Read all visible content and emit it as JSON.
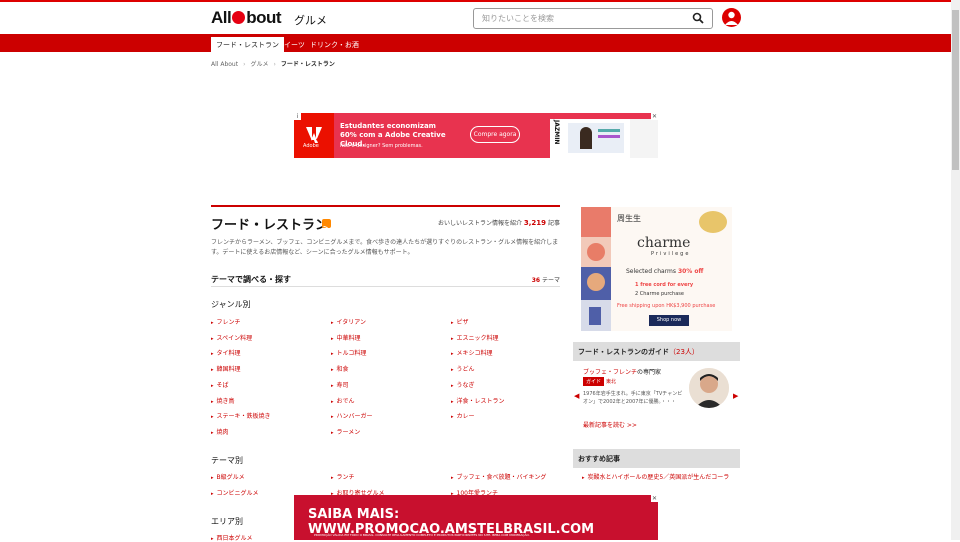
{
  "header": {
    "logo": "AllAbout",
    "category": "グルメ",
    "search_placeholder": "知りたいことを検索"
  },
  "nav": [
    {
      "label": "フード・レストラン",
      "active": true
    },
    {
      "label": "スイーツ",
      "active": false
    },
    {
      "label": "ドリンク・お酒",
      "active": false
    }
  ],
  "breadcrumb": [
    "All About",
    "グルメ",
    "フード・レストラン"
  ],
  "ad_top": {
    "brand": "Adobe",
    "headline": "Estudantes economizam 60% com a Adobe Creative Cloud.",
    "sub": "Não é designer? Sem problemas.",
    "button": "Compre agora",
    "side_brand": "JAZMIN"
  },
  "main": {
    "title": "フード・レストラン",
    "count_prefix": "おいしいレストラン情報を紹介",
    "count": "3,219",
    "count_suffix": "記事",
    "description": "フレンチからラーメン、ブッフェ、コンビニグルメまで。食べ歩きの達人たちが選りすぐりのレストラン・グルメ情報を紹介します。デートに使えるお店情報など、シーンに合ったグルメ情報もサポート。",
    "theme_title": "テーマで調べる・探す",
    "theme_count": "36",
    "theme_unit": "テーマ",
    "genre_title": "ジャンル別",
    "genres": [
      "フレンチ",
      "イタリアン",
      "ピザ",
      "スペイン料理",
      "中華料理",
      "エスニック料理",
      "タイ料理",
      "トルコ料理",
      "メキシコ料理",
      "韓国料理",
      "和食",
      "うどん",
      "そば",
      "寿司",
      "うなぎ",
      "焼き鳥",
      "おでん",
      "洋食・レストラン",
      "ステーキ・鉄板焼き",
      "ハンバーガー",
      "カレー",
      "焼肉",
      "ラーメン"
    ],
    "theme_section_title": "テーマ別",
    "themes": [
      "B級グルメ",
      "ランチ",
      "ブッフェ・食べ放題・バイキング",
      "コンビニグルメ",
      "お取り寄せグルメ",
      "100年愛ランチ"
    ],
    "area_title": "エリア別",
    "areas": [
      "西日本グルメ"
    ]
  },
  "side_ad": {
    "brand_cn": "周生生",
    "brand": "charme",
    "privilege": "Privilege",
    "line1": "Selected charms ",
    "line1_off": "30% off",
    "line2": "1 free cord for every",
    "line3": "2 Charme purchase",
    "line4": "Free shipping upon HK$3,900 purchase",
    "shop": "Shop now"
  },
  "guide": {
    "title": "フード・レストランのガイド",
    "count": "（23人）",
    "name": "ブッフェ・フレンチ",
    "name_suffix": "の専門家",
    "badge": "ガイド",
    "area": "東北",
    "bio": "1976年岩手生まれ。手に東京「TVチャンピオン」で2002年と2007年に優勝。・・・",
    "more": "最新記事を読む >>"
  },
  "recommend": {
    "title": "おすすめ記事",
    "item": "炭酸水とハイボールの歴史5／英国派が生んだコーラ"
  },
  "ad_bottom": {
    "text": "SAIBA MAIS: WWW.PROMOCAO.AMSTELBRASIL.COM",
    "fine": "PROMOÇÃO VÁLIDA EM TODO O BRASIL. CONSULTE REGULAMENTO COMPLETO E PRODUTOS PARTICIPANTES NO SITE. BEBA COM MODERAÇÃO."
  },
  "colors": {
    "brand_red": "#cc0000",
    "accent": "#e60012"
  }
}
